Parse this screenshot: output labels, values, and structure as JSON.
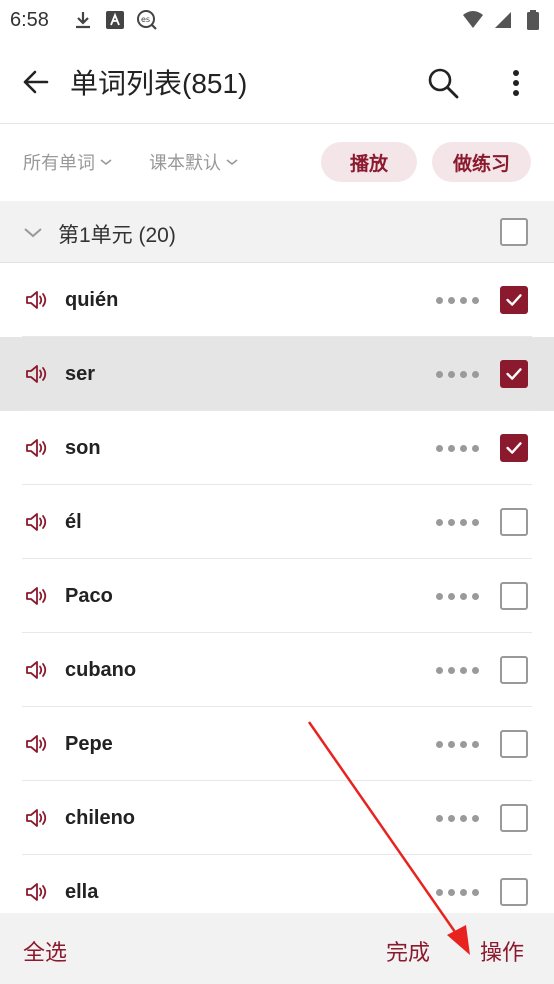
{
  "status_bar": {
    "time": "6:58",
    "left_icons": [
      "download-icon",
      "font-a-icon",
      "es-app-icon"
    ],
    "right_icons": [
      "wifi-icon",
      "signal-icon",
      "battery-icon"
    ]
  },
  "header": {
    "title": "单词列表(851)",
    "back_icon": "arrow-left-icon",
    "search_icon": "search-icon",
    "more_icon": "more-vertical-icon"
  },
  "filters": {
    "all_words": "所有单词",
    "book_default": "课本默认",
    "play_label": "播放",
    "practice_label": "做练习"
  },
  "unit": {
    "label": "第1单元 (20)",
    "checked": false
  },
  "words": [
    {
      "text": "quién",
      "checked": true,
      "highlight": false
    },
    {
      "text": "ser",
      "checked": true,
      "highlight": true
    },
    {
      "text": "son",
      "checked": true,
      "highlight": false
    },
    {
      "text": "él",
      "checked": false,
      "highlight": false
    },
    {
      "text": "Paco",
      "checked": false,
      "highlight": false
    },
    {
      "text": "cubano",
      "checked": false,
      "highlight": false
    },
    {
      "text": "Pepe",
      "checked": false,
      "highlight": false
    },
    {
      "text": "chileno",
      "checked": false,
      "highlight": false
    },
    {
      "text": "ella",
      "checked": false,
      "highlight": false
    }
  ],
  "bottom_bar": {
    "select_all": "全选",
    "done": "完成",
    "operate": "操作"
  },
  "colors": {
    "accent": "#8b1a2e",
    "pill_bg": "#f4e6e8",
    "annotation_arrow": "#e8231f"
  }
}
